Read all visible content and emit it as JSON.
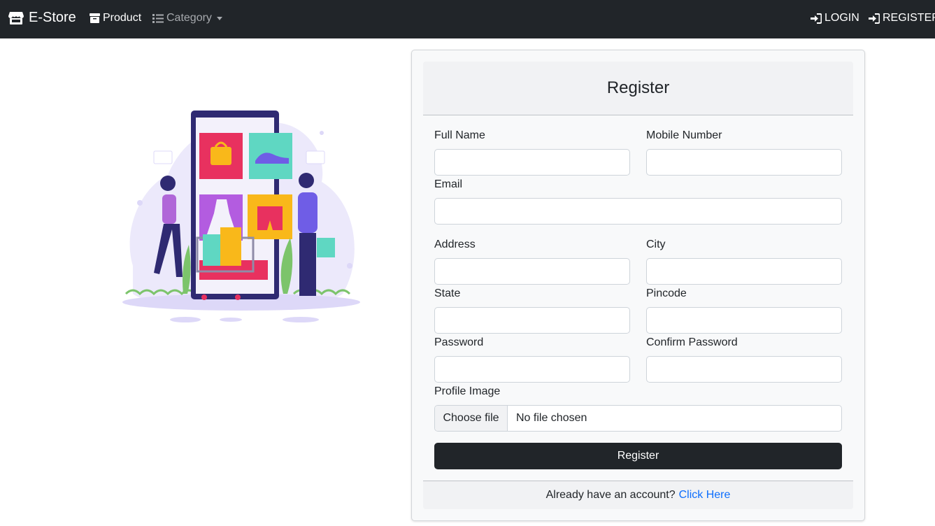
{
  "navbar": {
    "brand": "E-Store",
    "product": "Product",
    "category": "Category",
    "login": "LOGIN",
    "register": "REGISTER"
  },
  "form": {
    "title": "Register",
    "full_name_label": "Full Name",
    "mobile_label": "Mobile Number",
    "email_label": "Email",
    "address_label": "Address",
    "city_label": "City",
    "state_label": "State",
    "pincode_label": "Pincode",
    "password_label": "Password",
    "confirm_password_label": "Confirm Password",
    "profile_image_label": "Profile Image",
    "choose_file": "Choose file",
    "no_file": "No file chosen",
    "submit": "Register",
    "footer_text": "Already have an account?",
    "footer_link": "Click Here"
  },
  "colors": {
    "navbar_bg": "#212529",
    "link": "#0d6efd",
    "button_bg": "#212529"
  }
}
